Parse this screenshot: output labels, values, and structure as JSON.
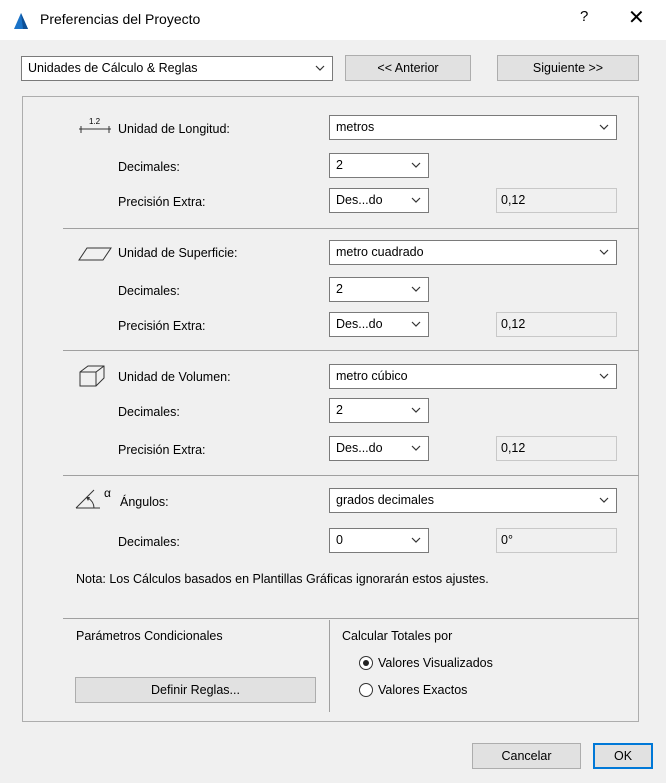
{
  "window": {
    "title": "Preferencias del Proyecto",
    "help": "?",
    "close": "✕"
  },
  "toolbar": {
    "category": "Unidades de Cálculo & Reglas",
    "prev": "<< Anterior",
    "next": "Siguiente >>"
  },
  "length": {
    "icon_label": "1.2",
    "label": "Unidad de Longitud:",
    "unit": "metros",
    "decimals_label": "Decimales:",
    "decimals": "2",
    "extra_label": "Precisión Extra:",
    "extra": "Des...do",
    "sample": "0,12"
  },
  "area": {
    "label": "Unidad de Superficie:",
    "unit": "metro cuadrado",
    "decimals_label": "Decimales:",
    "decimals": "2",
    "extra_label": "Precisión Extra:",
    "extra": "Des...do",
    "sample": "0,12"
  },
  "volume": {
    "label": "Unidad de Volumen:",
    "unit": "metro cúbico",
    "decimals_label": "Decimales:",
    "decimals": "2",
    "extra_label": "Precisión Extra:",
    "extra": "Des...do",
    "sample": "0,12"
  },
  "angles": {
    "icon_label": "α",
    "label": "Ángulos:",
    "unit": "grados decimales",
    "decimals_label": "Decimales:",
    "decimals": "0",
    "sample": "0°"
  },
  "note": "Nota: Los Cálculos basados en Plantillas Gráficas ignorarán estos ajustes.",
  "conditional": {
    "title": "Parámetros Condicionales",
    "button": "Definir Reglas..."
  },
  "totals": {
    "title": "Calcular Totales por",
    "options": [
      {
        "label": "Valores Visualizados",
        "selected": true
      },
      {
        "label": "Valores Exactos",
        "selected": false
      }
    ]
  },
  "footer": {
    "cancel": "Cancelar",
    "ok": "OK"
  },
  "colors": {
    "accent": "#0078d7",
    "app_icon_blue": "#1a73c8"
  }
}
